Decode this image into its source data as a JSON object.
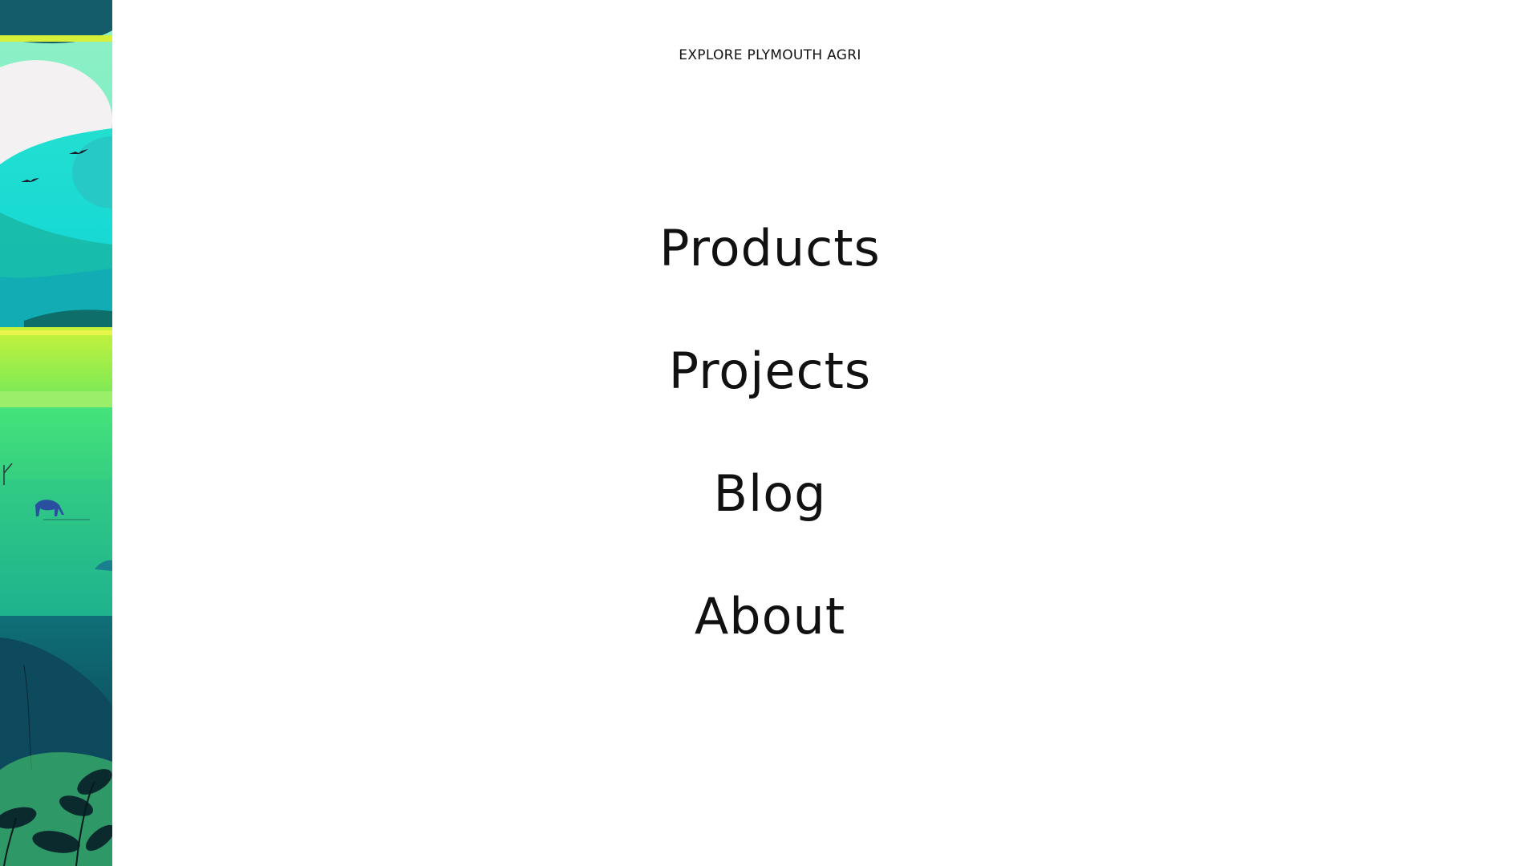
{
  "header": {
    "explore_label": "EXPLORE PLYMOUTH AGRI"
  },
  "menu": {
    "items": [
      {
        "label": "Products"
      },
      {
        "label": "Projects"
      },
      {
        "label": "Blog"
      },
      {
        "label": "About"
      }
    ]
  },
  "illustration": {
    "description_icon": "landscape-illustration",
    "colors": {
      "sky_teal": "#1ed9d2",
      "pale_mint": "#8ff0c5",
      "lime": "#a8ec4a",
      "grass": "#3fe07a",
      "deep_teal": "#0f7a78",
      "dark_navy": "#0b2f45"
    }
  }
}
